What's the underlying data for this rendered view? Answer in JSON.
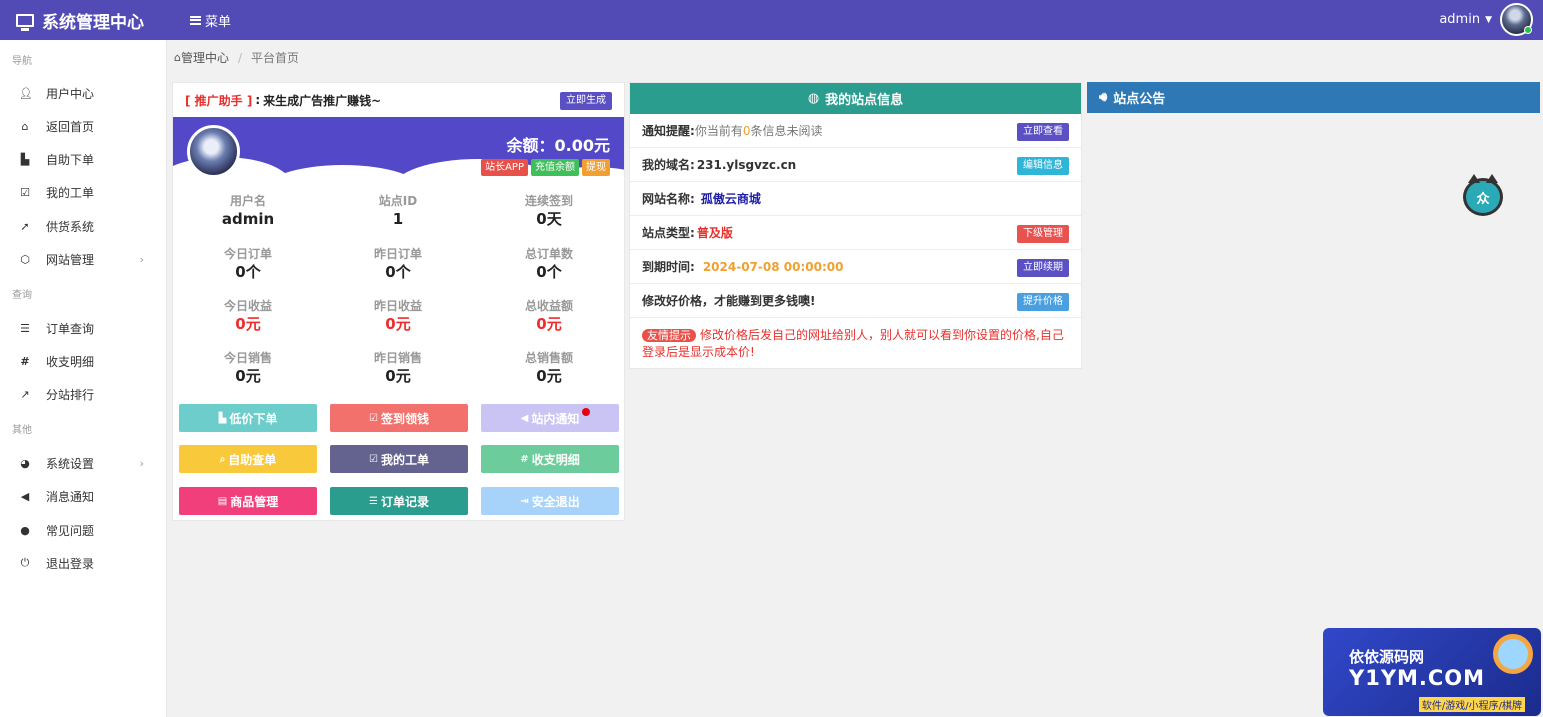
{
  "app": {
    "title": "系统管理中心",
    "menu_label": "菜单",
    "user": "admin"
  },
  "sidebar": {
    "sections": [
      "导航",
      "查询",
      "其他"
    ],
    "items": [
      {
        "label": "用户中心",
        "icon": "user-icon"
      },
      {
        "label": "返回首页",
        "icon": "home-icon"
      },
      {
        "label": "自助下单",
        "icon": "cart-icon"
      },
      {
        "label": "我的工单",
        "icon": "checkbox-icon"
      },
      {
        "label": "供货系统",
        "icon": "rocket-icon"
      },
      {
        "label": "网站管理",
        "icon": "cube-icon"
      },
      {
        "label": "订单查询",
        "icon": "list-icon"
      },
      {
        "label": "收支明细",
        "icon": "hash-icon"
      },
      {
        "label": "分站排行",
        "icon": "line-chart-icon"
      },
      {
        "label": "系统设置",
        "icon": "settings-icon"
      },
      {
        "label": "消息通知",
        "icon": "bullhorn-icon"
      },
      {
        "label": "常见问题",
        "icon": "info-icon"
      },
      {
        "label": "退出登录",
        "icon": "power-icon"
      }
    ]
  },
  "breadcrumb": {
    "home": "管理中心",
    "current": "平台首页"
  },
  "promo": {
    "tag": "[ 推广助手 ]",
    "sep": ":",
    "text": "来生成广告推广赚钱~",
    "button": "立即生成"
  },
  "account": {
    "balance": "余额：0.00元",
    "buttons": [
      "站长APP",
      "充值余额",
      "提现"
    ],
    "stats": [
      {
        "label": "用户名",
        "value": "admin"
      },
      {
        "label": "站点ID",
        "value": "1"
      },
      {
        "label": "连续签到",
        "value": "0天"
      },
      {
        "label": "今日订单",
        "value": "0个"
      },
      {
        "label": "昨日订单",
        "value": "0个"
      },
      {
        "label": "总订单数",
        "value": "0个"
      },
      {
        "label": "今日收益",
        "value": "0元"
      },
      {
        "label": "昨日收益",
        "value": "0元"
      },
      {
        "label": "总收益额",
        "value": "0元"
      },
      {
        "label": "今日销售",
        "value": "0元"
      },
      {
        "label": "昨日销售",
        "value": "0元"
      },
      {
        "label": "总销售额",
        "value": "0元"
      }
    ],
    "quick_buttons": [
      {
        "label": "低价下单",
        "icon": "cart-icon",
        "color": "#6ccdcb"
      },
      {
        "label": "签到领钱",
        "icon": "checkbox-icon",
        "color": "#f3716c"
      },
      {
        "label": "站内通知",
        "icon": "bullhorn-icon",
        "color": "#c9c4f3"
      },
      {
        "label": "自助查单",
        "icon": "search-icon",
        "color": "#f8c93a"
      },
      {
        "label": "我的工单",
        "icon": "checkbox-icon",
        "color": "#64638f"
      },
      {
        "label": "收支明细",
        "icon": "hash-icon",
        "color": "#6dcc9c"
      },
      {
        "label": "商品管理",
        "icon": "table-icon",
        "color": "#f03f7b"
      },
      {
        "label": "订单记录",
        "icon": "list-icon",
        "color": "#2a9d8f"
      },
      {
        "label": "安全退出",
        "icon": "signout-icon",
        "color": "#a7d3fb"
      }
    ]
  },
  "site_info": {
    "title": "我的站点信息",
    "rows": [
      {
        "label": "通知提醒:",
        "value_pre": "你当前有",
        "value_num": "0",
        "value_post": "条信息未阅读",
        "button": "立即查看",
        "btn_color": "#5a50c4"
      },
      {
        "label": "我的域名:",
        "value": "231.ylsgvzc.cn",
        "button": "编辑信息",
        "btn_color": "#2fb5d6"
      },
      {
        "label": "网站名称:",
        "value": "孤傲云商城"
      },
      {
        "label": "站点类型:",
        "value": "普及版",
        "button": "下级管理",
        "btn_color": "#e85350"
      },
      {
        "label": "到期时间:",
        "value": "2024-07-08 00:00:00",
        "button": "立即续期",
        "btn_color": "#5a50c4"
      },
      {
        "label": "修改好价格，才能赚到更多钱噢!",
        "button": "提升价格",
        "btn_color": "#4a9fe0"
      }
    ],
    "tip_badge": "友情提示",
    "tip_text": "修改价格后发自己的网址给别人，别人就可以看到你设置的价格,自己登录后是显示成本价!"
  },
  "announce": {
    "title": "站点公告"
  },
  "watermark": {
    "line1": "依依源码网",
    "line2": "Y1YM.COM",
    "line3": "软件/游戏/小程序/棋牌"
  },
  "floating": {
    "label": "众"
  }
}
